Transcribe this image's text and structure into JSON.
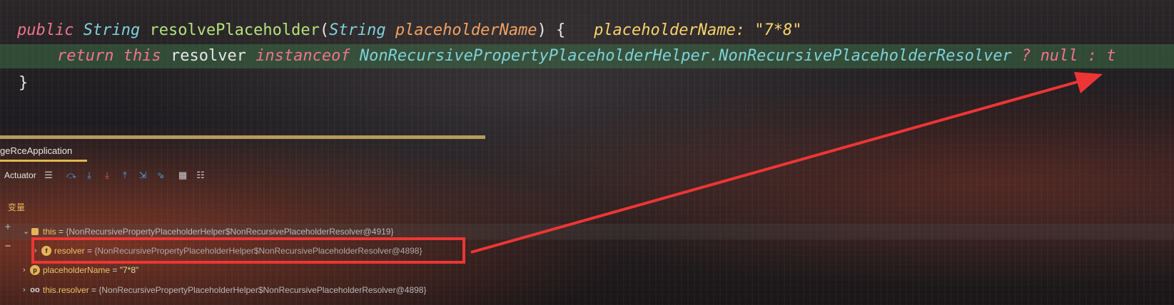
{
  "code": {
    "line1": {
      "modifier": "public",
      "return_type": "String",
      "method": "resolvePlaceholder",
      "paren_open": "(",
      "param_type": "String",
      "param_name": "placeholderName",
      "paren_close_brace": ") {",
      "hint_name": "placeholderName:",
      "hint_value": "\"7*8\""
    },
    "line2": {
      "kw_return": "return",
      "kw_this": "this",
      "field": "resolver",
      "kw_instanceof": "instanceof",
      "class_name": "NonRecursivePropertyPlaceholderHelper.NonRecursivePlaceholderResolver",
      "ternary": "?",
      "null_kw": "null",
      "colon": ":",
      "trailing": "t"
    },
    "line3": {
      "brace": "}"
    }
  },
  "debugger": {
    "tab_label": "geRceApplication",
    "toolbar_label": "Actuator",
    "variables_title": "变量",
    "variables": [
      {
        "name": "this",
        "eq": " = ",
        "value": "{NonRecursivePropertyPlaceholderHelper$NonRecursivePlaceholderResolver@4919}"
      },
      {
        "name": "resolver",
        "eq": " = ",
        "value": "{NonRecursivePropertyPlaceholderHelper$NonRecursivePlaceholderResolver@4898}"
      },
      {
        "name": "placeholderName",
        "eq": " = ",
        "value": "\"7*8\""
      },
      {
        "name": "this.resolver",
        "eq": " = ",
        "value": "{NonRecursivePropertyPlaceholderHelper$NonRecursivePlaceholderResolver@4898}"
      }
    ],
    "side_buttons": {
      "add": "+",
      "remove": "−"
    }
  },
  "icons": {
    "expand": "chevron-right-icon",
    "field_badge": "f",
    "param_badge": "p",
    "watch_badge": "oo"
  },
  "colors": {
    "highlight": "#ee3535",
    "arrow": "#ee3535",
    "exec_line": "#3c6e46",
    "accent": "#e0b74f"
  }
}
